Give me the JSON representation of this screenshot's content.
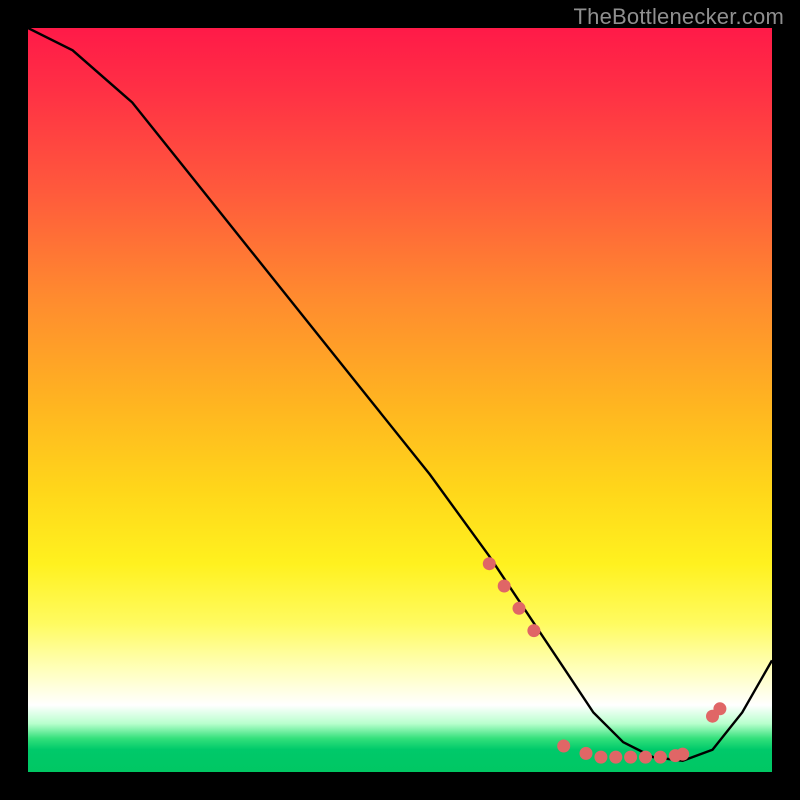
{
  "attribution": "TheBottlenecker.com",
  "chart_data": {
    "type": "line",
    "title": "",
    "xlabel": "",
    "ylabel": "",
    "xlim": [
      0,
      100
    ],
    "ylim": [
      0,
      100
    ],
    "series": [
      {
        "name": "curve",
        "x": [
          0,
          6,
          14,
          22,
          30,
          38,
          46,
          54,
          62,
          68,
          72,
          76,
          80,
          84,
          88,
          92,
          96,
          100
        ],
        "y": [
          100,
          97,
          90,
          80,
          70,
          60,
          50,
          40,
          29,
          20,
          14,
          8,
          4,
          2,
          1.5,
          3,
          8,
          15
        ]
      }
    ],
    "markers": {
      "name": "highlight-points",
      "color": "#e06666",
      "x": [
        62,
        64,
        66,
        68,
        72,
        75,
        77,
        79,
        81,
        83,
        85,
        87,
        88,
        92,
        93
      ],
      "y": [
        28,
        25,
        22,
        19,
        3.5,
        2.5,
        2,
        2,
        2,
        2,
        2,
        2.2,
        2.4,
        7.5,
        8.5
      ]
    },
    "background_gradient": {
      "stops": [
        {
          "pos": 0,
          "color": "#ff1a48"
        },
        {
          "pos": 50,
          "color": "#ffb321"
        },
        {
          "pos": 80,
          "color": "#fffb60"
        },
        {
          "pos": 95,
          "color": "#33e07b"
        },
        {
          "pos": 100,
          "color": "#00c763"
        }
      ]
    }
  }
}
